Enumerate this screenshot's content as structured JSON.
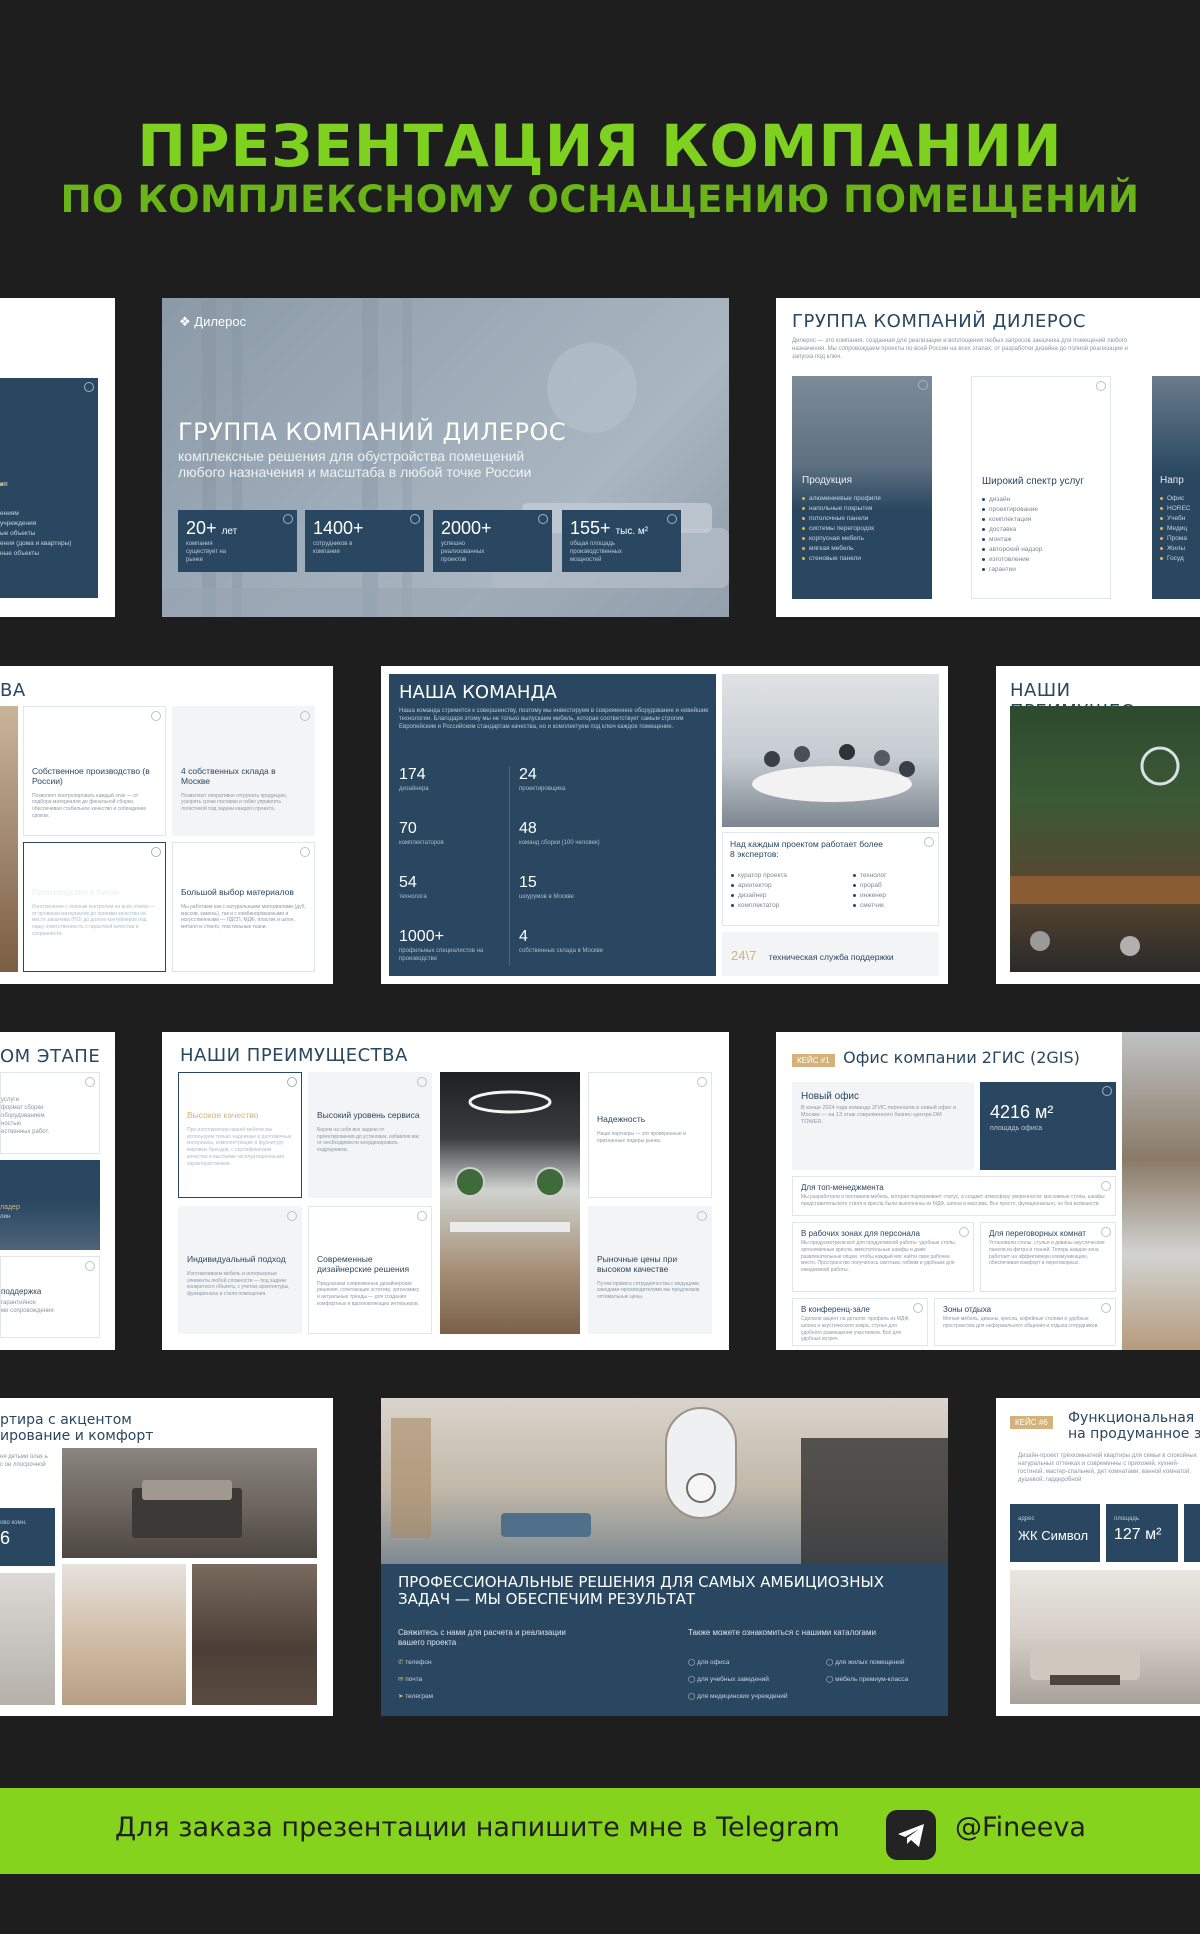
{
  "header": {
    "title": "ПРЕЗЕНТАЦИЯ КОМПАНИИ",
    "subtitle": "ПО КОМПЛЕКСНОМУ ОСНАЩЕНИЮ ПОМЕЩЕНИЙ"
  },
  "slide_hero": {
    "logo": "Дилерос",
    "title": "ГРУППА КОМПАНИЙ ДИЛЕРОС",
    "subtitle1": "комплексные решения для обустройства помещений",
    "subtitle2": "любого назначения и масштаба в любой точке России",
    "stats": [
      {
        "value": "20+",
        "unit": "лет",
        "label": "компания существует на рынке"
      },
      {
        "value": "1400+",
        "unit": "",
        "label": "сотрудников в компании"
      },
      {
        "value": "2000+",
        "unit": "",
        "label": "успешно реализованных проектов"
      },
      {
        "value": "155+",
        "unit": "тыс. м²",
        "label": "общая площадь производственных мощностей"
      }
    ]
  },
  "slide_group": {
    "title": "ГРУППА КОМПАНИЙ ДИЛЕРОС",
    "intro": "Дилерос — это компания, созданная для реализации и воплощения любых запросов заказчика для помещений любого назначения. Мы сопровождаем проекты по всей России на всех этапах: от разработки дизайна до полной реализации и запуска под ключ.",
    "products_title": "Продукция",
    "products": [
      "алюминиевые профиля",
      "напольные покрытия",
      "потолочные панели",
      "системы перегородок",
      "корпусная мебель",
      "мягкая мебель",
      "стеновые панели"
    ],
    "services_title": "Широкий спектр услуг",
    "services": [
      "дизайн",
      "проектирование",
      "комплектация",
      "доставка",
      "монтаж",
      "авторский надзор",
      "изготовление",
      "гарантии"
    ],
    "directions_title": "Напр",
    "directions": [
      "Офис",
      "HOREC",
      "Учебн",
      "Медиц",
      "Прома",
      "Жилы",
      "Госуд"
    ]
  },
  "slide_left1": {
    "items": [
      "ия",
      "ениям",
      "учреждения",
      "ые объекты",
      "ения (дома и квартиры)",
      "ные объекты"
    ]
  },
  "slide_left2": {
    "title": "ВА",
    "cards": [
      {
        "title": "Собственное производство (в России)",
        "text": "Позволяет контролировать каждый этап — от подбора материалов до финальной сборки, обеспечивая стабильное качество и соблюдение сроков."
      },
      {
        "title": "4 собственных склада в Москве",
        "text": "Позволяют оперативно отгружать продукцию, ускорять сроки поставки и гибко управлять логистикой под задачи каждого проекта."
      },
      {
        "title": "Производство в Китае",
        "text": "Изготовление с полным контролем на всех этапах — от проверки материалов до приемки качества на месте заказчика (ПО) до долгих контейнеров под нашу ответственность с гарантией качества и сохранности."
      },
      {
        "title": "Большой выбор материалов",
        "text": "Мы работаем как с натуральными материалами (дуб, массив, камень), так и с комбинированными и искусственными — ЛДСП, МДФ, пластик и шпон, металл и стекло, текстильные ткани."
      }
    ]
  },
  "slide_team": {
    "title": "НАША КОМАНДА",
    "intro": "Наша команда стремится к совершенству, поэтому мы инвестируем в современное оборудование и новейшие технологии. Благодаря этому мы не только выпускаем мебель, которая соответствует самым строгим Европейским и Российским стандартам качества, но и комплектуем под ключ каждое помещение.",
    "stats": [
      {
        "value": "174",
        "label": "дизайнера"
      },
      {
        "value": "24",
        "label": "проектировщика"
      },
      {
        "value": "70",
        "label": "комплектаторов"
      },
      {
        "value": "48",
        "label": "команд сборки (100 человек)"
      },
      {
        "value": "54",
        "label": "технолога"
      },
      {
        "value": "15",
        "label": "шоурумов в Москве"
      },
      {
        "value": "1000+",
        "label": "профильных специалистов на производстве"
      },
      {
        "value": "4",
        "label": "собственных склада в Москве"
      }
    ],
    "experts_title": "Над каждым проектом работает более 8 экспертов:",
    "experts_col1": [
      "куратор проекта",
      "архитектор",
      "дизайнер",
      "комплектатор"
    ],
    "experts_col2": [
      "технолог",
      "прораб",
      "инженер",
      "сметчик"
    ],
    "support_num": "24\\7",
    "support_text": "техническая служба поддержки"
  },
  "slide_adv_right": {
    "title": "НАШИ ПРЕИМУЩЕС"
  },
  "slide_left3": {
    "title": "ОМ ЭТАПЕ",
    "items": [
      "услуги",
      "формат сборки",
      "оборудованием",
      "ностью",
      "ественных работ.",
      "ладер",
      "лин",
      "поддержка",
      "гарантийное",
      "ме сопровождения"
    ]
  },
  "slide_adv": {
    "title": "НАШИ ПРЕИМУЩЕСТВА",
    "cards": [
      {
        "title": "Высокое качество",
        "text": "При изготовлении нашей мебели мы используем только надежные и долговечные материалы, комплектующие и фурнитуру мировых брендов, с сертификатами качества и высокими эксплуатационными характеристиками."
      },
      {
        "title": "Высокий уровень сервиса",
        "text": "Берем на себя все задачи от проектирования до установки, избавляя вас от необходимости координировать подрядчиков."
      },
      {
        "title": "Надежность",
        "text": "Наши партнеры — это проверенные и признанные лидеры рынка."
      },
      {
        "title": "Индивидуальный подход",
        "text": "Изготавливаем мебель и интерьерные элементы любой сложности — под задачи конкретного объекта, с учетом архитектуры, функционала и стиля помещения."
      },
      {
        "title": "Современные дизайнерские решения",
        "text": "Предлагаем современные дизайнерские решения, сочетающие эстетику, эргономику и актуальные тренды — для создания комфортных и вдохновляющих интерьеров."
      },
      {
        "title": "Рыночные цены при высоком качестве",
        "text": "Путем прямого сотрудничества с ведущими заводами-производителями мы предлагаем оптимальные цены."
      }
    ]
  },
  "slide_case1": {
    "badge": "КЕЙС #1",
    "title": "Офис компании 2ГИС (2GIS)",
    "new_office_title": "Новый офис",
    "new_office_text": "В конце 2024 года команда 2ГИС переехала в новый офис в Москве — на 13 этаж современного бизнес-центра DM TOWER.",
    "area_value": "4216 м²",
    "area_label": "площадь офиса",
    "blocks": [
      {
        "title": "Для топ-менеджмента",
        "text": "Мы разработали и поставили мебель, которая подчеркивает статус, а создает атмосферу уверенности: массивные столы, шкафы представительского стиля и кресла были выполнены из МДФ, шпона и массива. Все просто, функционально, но без излишеств."
      },
      {
        "title": "В рабочих зонах для персонала",
        "text": "Мы предусмотрели всё для продуктивной работы: удобные столы, эргономичные кресла, вместительные шкафы и даже развлекательные опции, чтобы каждый мог найти свое рабочее место. Пространство получилось светлым, гибким и удобным для ежедневной работы."
      },
      {
        "title": "Для переговорных комнат",
        "text": "Установили столы, стулья и диваны акустические панели из фетра и тканей. Теперь каждая зона работает на эффективную коммуникацию, обеспечивая комфорт в переговорных."
      },
      {
        "title": "В конференц-зале",
        "text": "Сделали акцент на деталях: профиль из МДФ, шпона и акустического ковра, стулья для удобного размещения участников. Всё для удобных встреч."
      },
      {
        "title": "Зоны отдыха",
        "text": "Мягкая мебель, диваны, кресла, кофейные столики и удобные пространства для неформального общения и отдыха сотрудников."
      }
    ]
  },
  "slide_apartment": {
    "title1": "ртира с акцентом",
    "title2": "ирование и комфорт",
    "text": "ня детьми олах ь с ое лпосрочной",
    "label": "ово комн.",
    "value": "6"
  },
  "slide_contact": {
    "title": "ПРОФЕССИОНАЛЬНЫЕ РЕШЕНИЯ ДЛЯ САМЫХ АМБИЦИОЗНЫХ ЗАДАЧ — МЫ ОБЕСПЕЧИМ РЕЗУЛЬТАТ",
    "left_title": "Свяжитесь с нами для расчета и реализации вашего проекта",
    "contacts": [
      "телефон",
      "почта",
      "телеграм"
    ],
    "right_title": "Также можете ознакомиться с нашими каталогами",
    "catalogs_col1": [
      "для офиса",
      "для учебных заведений",
      "для медицинских учреждений"
    ],
    "catalogs_col2": [
      "для жилых помещений",
      "мебель премиум-класса"
    ]
  },
  "slide_case6": {
    "badge": "КЕЙС #6",
    "title1": "Функциональная",
    "title2": "на продуманное з",
    "text": "Дизайн-проект трёхкомнатной квартиры для семьи в спокойных натуральных оттенках и современны с прихожей, кухней-гостиной, мастер-спальней, дет комнатами, ванной комнатой, душевой, гардеробной",
    "address_label": "адрес",
    "address_value": "ЖК Символ",
    "area_label": "площадь",
    "area_value": "127 м²"
  },
  "footer": {
    "text": "Для заказа презентации напишите мне в Telegram",
    "handle": "@Fineeva",
    "icon": "telegram-icon"
  },
  "colors": {
    "accent": "#7fd11f",
    "navy": "#294761",
    "footer": "#86d31e",
    "background": "#1e1e1e",
    "gold": "#d4b27a"
  }
}
